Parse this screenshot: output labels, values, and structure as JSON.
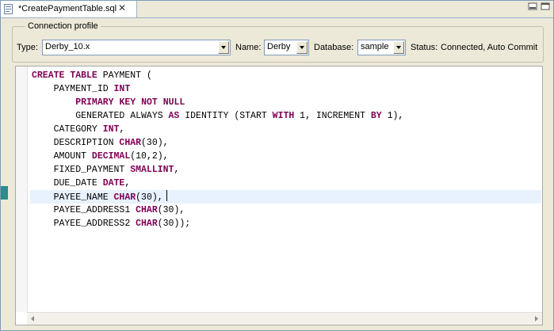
{
  "tab": {
    "title": "*CreatePaymentTable.sql",
    "close_glyph": "✕"
  },
  "connection": {
    "group_title": "Connection profile",
    "type_label": "Type:",
    "type_value": "Derby_10.x",
    "name_label": "Name:",
    "name_value": "Derby",
    "database_label": "Database:",
    "database_value": "sample",
    "status_label": "Status:",
    "status_value": "Connected, Auto Commit"
  },
  "code_lines": [
    [
      [
        "kw",
        "CREATE"
      ],
      [
        "t",
        " "
      ],
      [
        "kw",
        "TABLE"
      ],
      [
        "t",
        " PAYMENT ("
      ]
    ],
    [
      [
        "t",
        "    PAYMENT_ID "
      ],
      [
        "kw",
        "INT"
      ]
    ],
    [
      [
        "t",
        "        "
      ],
      [
        "kw",
        "PRIMARY"
      ],
      [
        "t",
        " "
      ],
      [
        "kw",
        "KEY"
      ],
      [
        "t",
        " "
      ],
      [
        "kw",
        "NOT"
      ],
      [
        "t",
        " "
      ],
      [
        "kw",
        "NULL"
      ]
    ],
    [
      [
        "t",
        "        GENERATED ALWAYS "
      ],
      [
        "kw",
        "AS"
      ],
      [
        "t",
        " IDENTITY (START "
      ],
      [
        "kw",
        "WITH"
      ],
      [
        "t",
        " 1, INCREMENT "
      ],
      [
        "kw",
        "BY"
      ],
      [
        "t",
        " 1),"
      ]
    ],
    [
      [
        "t",
        "    CATEGORY "
      ],
      [
        "kw",
        "INT"
      ],
      [
        "t",
        ","
      ]
    ],
    [
      [
        "t",
        "    DESCRIPTION "
      ],
      [
        "kw",
        "CHAR"
      ],
      [
        "t",
        "(30),"
      ]
    ],
    [
      [
        "t",
        "    AMOUNT "
      ],
      [
        "kw",
        "DECIMAL"
      ],
      [
        "t",
        "(10,2),"
      ]
    ],
    [
      [
        "t",
        "    FIXED_PAYMENT "
      ],
      [
        "kw",
        "SMALLINT"
      ],
      [
        "t",
        ","
      ]
    ],
    [
      [
        "t",
        "    DUE_DATE "
      ],
      [
        "kw",
        "DATE"
      ],
      [
        "t",
        ","
      ]
    ],
    [
      [
        "t",
        "    PAYEE_NAME "
      ],
      [
        "kw",
        "CHAR"
      ],
      [
        "t",
        "(30),"
      ]
    ],
    [
      [
        "t",
        "    PAYEE_ADDRESS1 "
      ],
      [
        "kw",
        "CHAR"
      ],
      [
        "t",
        "(30),"
      ]
    ],
    [
      [
        "t",
        "    PAYEE_ADDRESS2 "
      ],
      [
        "kw",
        "CHAR"
      ],
      [
        "t",
        "(30));"
      ]
    ]
  ],
  "current_line_index": 9,
  "colors": {
    "keyword": "#7f0055",
    "current_line": "#e8f2fe",
    "marker": "#2c8b8b"
  }
}
